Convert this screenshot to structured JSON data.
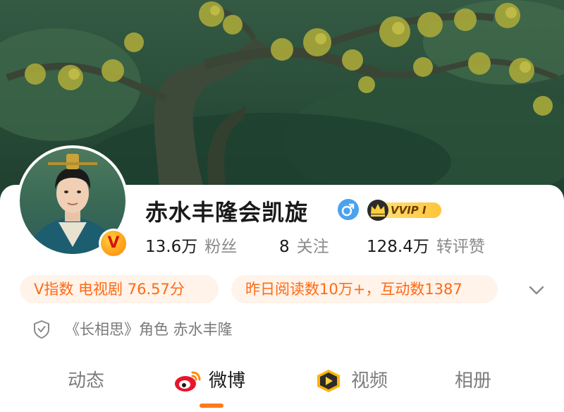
{
  "profile": {
    "name": "赤水丰隆会凯旋",
    "gender_icon": "male-symbol-icon",
    "vip_badge": "VVIP I",
    "verified_badge_letter": "V"
  },
  "stats": [
    {
      "value": "13.6万",
      "label": "粉丝"
    },
    {
      "value": "8",
      "label": "关注"
    },
    {
      "value": "128.4万",
      "label": "转评赞"
    }
  ],
  "chips": [
    {
      "text": "V指数 电视剧 76.57分"
    },
    {
      "text": "昨日阅读数10万+，互动数1387"
    }
  ],
  "verification": {
    "text": "《长相思》角色 赤水丰隆",
    "icon": "shield-check-icon"
  },
  "tabs": [
    {
      "label": "动态",
      "active": false
    },
    {
      "label": "微博",
      "active": true,
      "icon": "weibo-logo-icon"
    },
    {
      "label": "视频",
      "active": false,
      "icon": "video-play-icon"
    },
    {
      "label": "相册",
      "active": false
    }
  ],
  "colors": {
    "accent": "#ff6a13",
    "chip_bg": "#fff3ea",
    "gender_blue": "#4aa3ef",
    "vip_gold": "#ffc43a",
    "tab_indicator": "#ff7a1a"
  }
}
